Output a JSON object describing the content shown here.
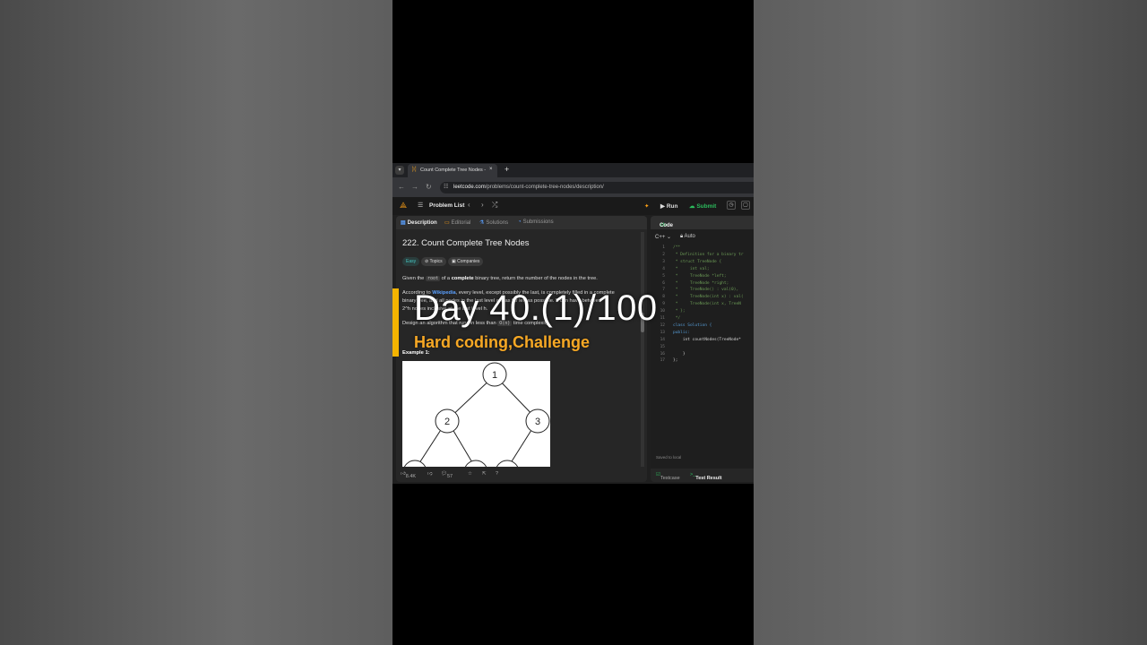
{
  "browser": {
    "tab_title": "Count Complete Tree Nodes - I",
    "tab_close": "×",
    "new_tab": "+",
    "url_host": "leetcode.com",
    "url_path": "/problems/count-complete-tree-nodes/description/"
  },
  "topbar": {
    "problem_list": "Problem List",
    "run": "Run",
    "submit": "Submit"
  },
  "left_tabs": [
    "Description",
    "Editorial",
    "Solutions",
    "Submissions"
  ],
  "problem": {
    "title": "222. Count Complete Tree Nodes",
    "badges": [
      "Easy",
      "Topics",
      "Companies"
    ],
    "p1_a": "Given the",
    "p1_code": "root",
    "p1_b": "of a",
    "p1_bold": "complete",
    "p1_c": "binary tree, return the number of the nodes in the tree.",
    "p2_a": "According to",
    "p2_link": "Wikipedia",
    "p2_b": ", every level, except possibly the last, is completely filled in a complete",
    "p3": "binary tree, and all nodes in the last level are as far left as possible. It can have between",
    "p4": "2^h nodes inclusive at the last level h.",
    "p5_a": "Design an algorithm that runs in less than",
    "p5_code": "O(n)",
    "p5_b": "time complexity.",
    "example": "Example 1:",
    "tree_nodes": [
      "1",
      "2",
      "3"
    ]
  },
  "left_footer": {
    "likes": "8.4K",
    "comments": "57"
  },
  "code_panel": {
    "title": "Code",
    "lang": "C++",
    "mode": "Auto",
    "lines": [
      {
        "n": "1",
        "t": "/**",
        "c": ""
      },
      {
        "n": "2",
        "t": " * Definition for a binary tr",
        "c": ""
      },
      {
        "n": "3",
        "t": " * struct TreeNode {",
        "c": ""
      },
      {
        "n": "4",
        "t": " *     int val;",
        "c": ""
      },
      {
        "n": "5",
        "t": " *     TreeNode *left;",
        "c": ""
      },
      {
        "n": "6",
        "t": " *     TreeNode *right;",
        "c": ""
      },
      {
        "n": "7",
        "t": " *     TreeNode() : val(0),",
        "c": ""
      },
      {
        "n": "8",
        "t": " *     TreeNode(int x) : val(",
        "c": ""
      },
      {
        "n": "9",
        "t": " *     TreeNode(int x, TreeN",
        "c": ""
      },
      {
        "n": "10",
        "t": " * };",
        "c": ""
      },
      {
        "n": "11",
        "t": " */",
        "c": ""
      },
      {
        "n": "12",
        "t": "class Solution {",
        "c": "k"
      },
      {
        "n": "13",
        "t": "public:",
        "c": "k"
      },
      {
        "n": "14",
        "t": "    int countNodes(TreeNode*",
        "c": "p"
      },
      {
        "n": "15",
        "t": "",
        "c": "p"
      },
      {
        "n": "16",
        "t": "    }",
        "c": "p"
      },
      {
        "n": "17",
        "t": "};",
        "c": "p"
      }
    ],
    "saved": "Saved to local",
    "testcase": "Testcase",
    "test_result": "Test Result"
  },
  "overlay": {
    "title": "Day 40.(1)/100",
    "subtitle": "Hard coding,Challenge",
    "accent_color": "#f5b400",
    "subtitle_color": "#f7a824"
  }
}
